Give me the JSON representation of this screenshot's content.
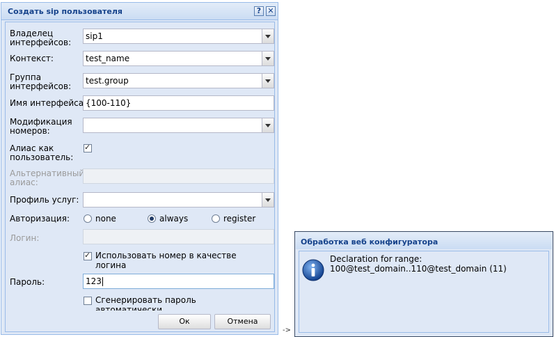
{
  "dialog": {
    "title": "Создать sip пользователя",
    "help_tool": "?",
    "close_tool": "✕",
    "fields": {
      "owner": {
        "label_line1": "Владелец",
        "label_line2": "интерфейсов:",
        "value": "sip1"
      },
      "context": {
        "label": "Контекст:",
        "value": "test_name"
      },
      "group": {
        "label_line1": "Группа",
        "label_line2": "интерфейсов:",
        "value": "test.group"
      },
      "iface_name": {
        "label": "Имя интерфейса:",
        "value": "{100-110}"
      },
      "num_mod": {
        "label_line1": "Модификация",
        "label_line2": "номеров:",
        "value": ""
      },
      "alias_as_user": {
        "label_line1": "Алиас как",
        "label_line2": "пользователь:",
        "checked": true
      },
      "alt_alias": {
        "label_line1": "Альтернативный",
        "label_line2": "алиас:",
        "value": ""
      },
      "service_profile": {
        "label": "Профиль услуг:",
        "value": ""
      },
      "auth": {
        "label": "Авторизация:",
        "options": [
          "none",
          "always",
          "register"
        ],
        "selected": "always"
      },
      "login": {
        "label": "Логин:",
        "value": ""
      },
      "use_number_as_login": {
        "label_line1": "Использовать номер в качестве",
        "label_line2": "логина",
        "checked": true
      },
      "password": {
        "label": "Пароль:",
        "value": "123"
      },
      "gen_password": {
        "label_line1": "Сгенерировать пароль",
        "label_line2": "автоматически",
        "checked": false
      }
    },
    "buttons": {
      "ok": "Ок",
      "cancel": "Отмена"
    }
  },
  "connector": "->",
  "message": {
    "title": "Обработка веб конфигуратора",
    "line1": "Declaration for range:",
    "line2": "100@test_domain..110@test_domain (11)",
    "icon": "info-icon"
  }
}
